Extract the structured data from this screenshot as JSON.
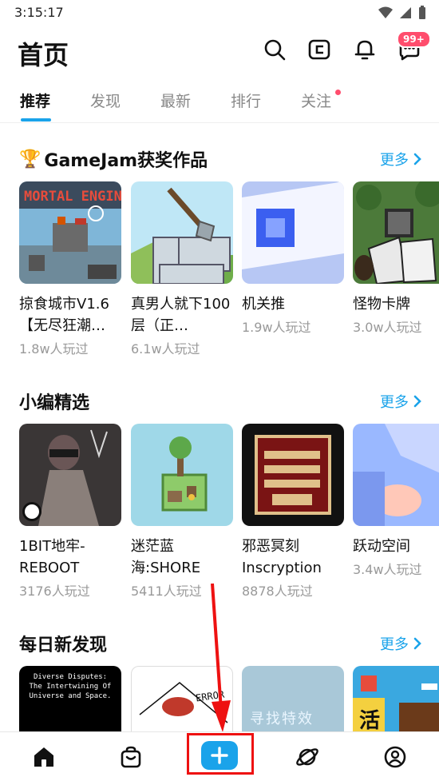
{
  "status_bar": {
    "time": "3:15:17"
  },
  "header": {
    "title": "首页",
    "badge": "99+"
  },
  "tabs": [
    {
      "label": "推荐",
      "active": true
    },
    {
      "label": "发现",
      "active": false
    },
    {
      "label": "最新",
      "active": false
    },
    {
      "label": "排行",
      "active": false
    },
    {
      "label": "关注",
      "active": false,
      "dot": true
    }
  ],
  "sections": [
    {
      "title": "GameJam获奖作品",
      "trophy": "🏆",
      "more": "更多",
      "cards": [
        {
          "name": "掠食城市V1.6【无尽狂潮…",
          "plays": "1.8w人玩过"
        },
        {
          "name": "真男人就下100层（正…",
          "plays": "6.1w人玩过"
        },
        {
          "name": "机关推",
          "plays": "1.9w人玩过"
        },
        {
          "name": "怪物卡牌",
          "plays": "3.0w人玩过"
        }
      ]
    },
    {
      "title": "小编精选",
      "more": "更多",
      "cards": [
        {
          "name": "1BIT地牢-REBOOT",
          "plays": "3176人玩过"
        },
        {
          "name": "迷茫蓝海:SHORE",
          "plays": "5411人玩过"
        },
        {
          "name": "邪恶冥刻Inscryption",
          "plays": "8878人玩过"
        },
        {
          "name": "跃动空间",
          "plays": "3.4w人玩过"
        }
      ]
    },
    {
      "title": "每日新发现",
      "more": "更多",
      "cards": [
        {
          "thumb_text": "Diverse Disputes: The Intertwining Of Universe and Space."
        },
        {
          "thumb_text": "ERROR"
        },
        {
          "thumb_text": "寻找特效"
        },
        {
          "thumb_text": "活"
        }
      ]
    }
  ],
  "colors": {
    "accent": "#1aa3ea",
    "badge": "#ff4d6d",
    "annotation": "#e11111"
  },
  "bottom_nav": [
    {
      "icon": "home-icon"
    },
    {
      "icon": "shopping-bag-icon"
    },
    {
      "icon": "plus-icon"
    },
    {
      "icon": "planet-icon"
    },
    {
      "icon": "profile-icon"
    }
  ]
}
